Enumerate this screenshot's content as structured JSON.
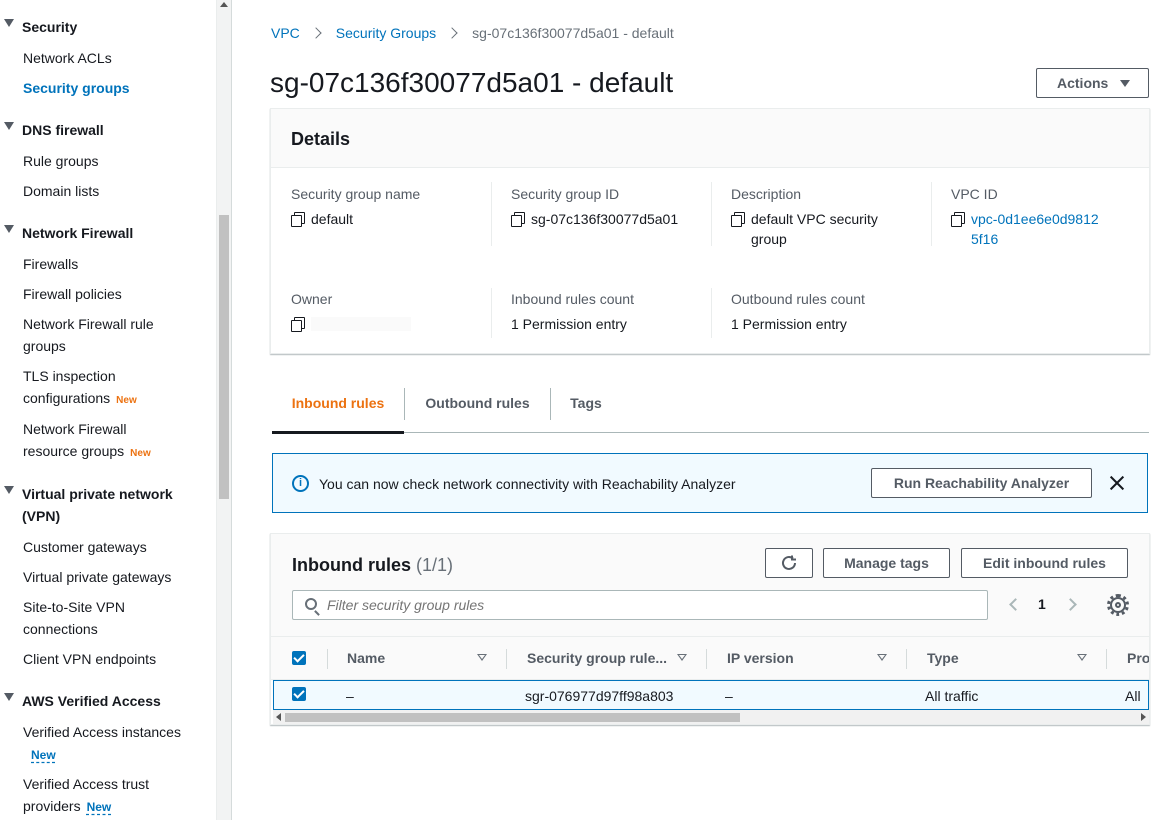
{
  "colors": {
    "link": "#0073bb",
    "active_tab": "#ec7211",
    "new_badge": "#ec7211",
    "alert_bg": "#f1faff"
  },
  "sidebar": {
    "sections": [
      {
        "label": "Security",
        "items": [
          "Network ACLs",
          "Security groups"
        ]
      },
      {
        "label": "DNS firewall",
        "items": [
          "Rule groups",
          "Domain lists"
        ]
      },
      {
        "label": "Network Firewall",
        "items": [
          "Firewalls",
          "Firewall policies",
          "Network Firewall rule groups",
          "TLS inspection configurations",
          "Network Firewall resource groups"
        ]
      },
      {
        "label": "Virtual private network (VPN)",
        "items": [
          "Customer gateways",
          "Virtual private gateways",
          "Site-to-Site VPN connections",
          "Client VPN endpoints"
        ]
      },
      {
        "label": "AWS Verified Access",
        "items": [
          "Verified Access instances",
          "Verified Access trust providers"
        ]
      }
    ],
    "new_label": "New",
    "active_item": "Security groups"
  },
  "breadcrumb": {
    "items": [
      "VPC",
      "Security Groups"
    ],
    "current": "sg-07c136f30077d5a01 - default"
  },
  "page_title": "sg-07c136f30077d5a01 - default",
  "actions_label": "Actions",
  "details": {
    "title": "Details",
    "fields": {
      "sg_name": {
        "label": "Security group name",
        "value": "default"
      },
      "sg_id": {
        "label": "Security group ID",
        "value": "sg-07c136f30077d5a01"
      },
      "description": {
        "label": "Description",
        "value": "default VPC security group"
      },
      "vpc_id": {
        "label": "VPC ID",
        "value": "vpc-0d1ee6e0d98125f16"
      },
      "owner": {
        "label": "Owner",
        "value": ""
      },
      "inbound_count": {
        "label": "Inbound rules count",
        "value": "1 Permission entry"
      },
      "outbound_count": {
        "label": "Outbound rules count",
        "value": "1 Permission entry"
      }
    }
  },
  "tabs": [
    "Inbound rules",
    "Outbound rules",
    "Tags"
  ],
  "alert": {
    "text": "You can now check network connectivity with Reachability Analyzer",
    "button": "Run Reachability Analyzer"
  },
  "rules": {
    "title": "Inbound rules",
    "count": "(1/1)",
    "manage_tags": "Manage tags",
    "edit_rules": "Edit inbound rules",
    "search_placeholder": "Filter security group rules",
    "page": "1",
    "columns": [
      "Name",
      "Security group rule...",
      "IP version",
      "Type",
      "Pro"
    ],
    "rows": [
      {
        "name": "–",
        "rule_id": "sgr-076977d97ff98a803",
        "ip_version": "–",
        "type": "All traffic",
        "protocol": "All"
      }
    ]
  }
}
